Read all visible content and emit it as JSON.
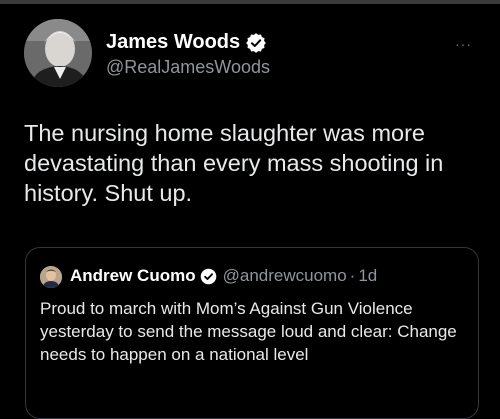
{
  "tweet": {
    "author": {
      "display_name": "James Woods",
      "handle": "@RealJamesWoods",
      "verified": true,
      "avatar_icon": "profile-photo"
    },
    "more_label": "···",
    "text": "The nursing home slaughter was more devastating than every mass shooting in history. Shut up."
  },
  "quoted_tweet": {
    "author": {
      "display_name": "Andrew Cuomo",
      "handle": "@andrewcuomo",
      "verified": true,
      "avatar_icon": "profile-photo"
    },
    "separator": "·",
    "time": "1d",
    "text": "Proud to march with Mom’s Against Gun Violence yesterday to send the message loud and clear: Change needs to happen on a national level"
  },
  "colors": {
    "background": "#000000",
    "text_primary": "#e7e9ea",
    "text_secondary": "#8f959a",
    "verified_badge": "#ffffff",
    "quote_border": "#33363a"
  }
}
